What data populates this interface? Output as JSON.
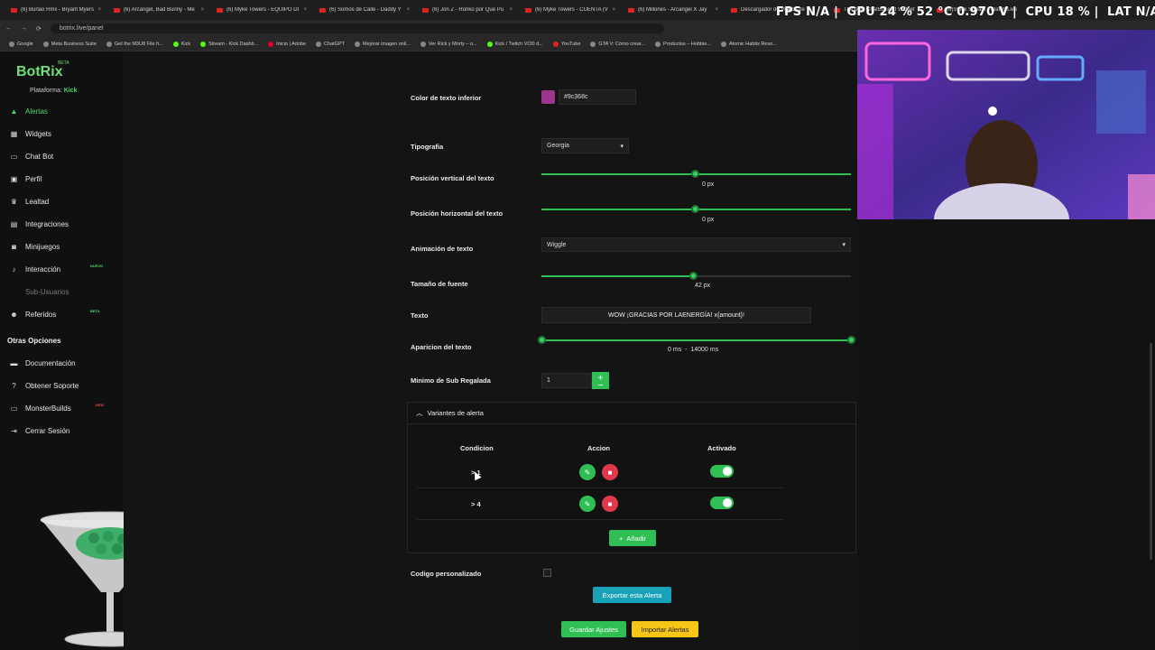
{
  "browser": {
    "tabs": [
      "(6) Burlao Rmx - Bryant Myers",
      "(6) Arcángel, Bad Bunny - Me",
      "(6) Myke Towers - EQUIPO DI",
      "(6) Somos de Calle - Daddy Y",
      "(6) Jon Z - Ronko por Que Pu",
      "(6) Myke Towers - CUENTA (V",
      "(6) Millones - Arcangel X Jay",
      "Descargador de Videos de Y",
      "The best ChatBot and Widget",
      "(6)Stock Stream - Watch Live"
    ],
    "url": "botrix.live/panel",
    "bookmarks": [
      "Google",
      "Meta Business Suite",
      "Get the M3U8 File fr...",
      "Kick",
      "Stream - Kick Dashb...",
      "Inicio | Adobe",
      "ChatGPT",
      "Mejorar imagen onli...",
      "Ver Rick y Morty – o...",
      "Kick / Twitch VOD d...",
      "YouTube",
      "GTA V: Cómo crear...",
      "Productos – Hobbie...",
      "Atomic Habits Reso..."
    ]
  },
  "overlay": {
    "fps_label": "FPS",
    "fps_value": "N/A",
    "gpu_label": "GPU",
    "gpu_value": "24 % 52 °C 0.970 V",
    "cpu_label": "CPU",
    "cpu_value": "18 %",
    "lat_label": "LAT",
    "lat_value": "N/A"
  },
  "sidebar": {
    "logo": "BotRix",
    "beta": "BETA",
    "platform_label": "Plataforma:",
    "platform_value": "Kick",
    "items": [
      {
        "label": "Alertas",
        "icon": "bell-icon"
      },
      {
        "label": "Widgets",
        "icon": "widgets-icon"
      },
      {
        "label": "Chat Bot",
        "icon": "chat-icon"
      },
      {
        "label": "Perfil",
        "icon": "profile-icon"
      },
      {
        "label": "Lealtad",
        "icon": "trophy-icon"
      },
      {
        "label": "Integraciones",
        "icon": "integrations-icon"
      },
      {
        "label": "Minijuegos",
        "icon": "gamepad-icon"
      },
      {
        "label": "Interacción",
        "icon": "music-icon",
        "tag": "NUEVO"
      },
      {
        "label": "Sub-Usuarios",
        "icon": "users-icon"
      },
      {
        "label": "Referidos",
        "icon": "referral-icon",
        "tag": "BETA"
      }
    ],
    "other_title": "Otras Opciones",
    "other_items": [
      {
        "label": "Documentación",
        "icon": "book-icon"
      },
      {
        "label": "Obtener Soporte",
        "icon": "help-icon"
      },
      {
        "label": "MonsterBuilds",
        "icon": "monitor-icon",
        "tag": "NEW"
      },
      {
        "label": "Cerrar Sesión",
        "icon": "logout-icon"
      }
    ]
  },
  "form": {
    "bottom_text_color_label": "Color de texto inferior",
    "bottom_text_color_value": "#9c368c",
    "typography_label": "Tipografia",
    "typography_value": "Georgia",
    "vpos_label": "Posición vertical del texto",
    "vpos_value": "0",
    "vpos_unit": "px",
    "hpos_label": "Posición horizontal del texto",
    "hpos_value": "0",
    "hpos_unit": "px",
    "anim_label": "Animación de texto",
    "anim_value": "Wiggle",
    "font_size_label": "Tamaño de fuente",
    "font_size_value": "42",
    "font_size_unit": "px",
    "text_label": "Texto",
    "text_value": "WOW ¡GRACIAS POR LAENERGÍA! x{amount}!",
    "appear_label": "Aparicion del texto",
    "appear_start": "0",
    "appear_end": "14000",
    "appear_unit": "ms",
    "appear_sep": "-",
    "min_sub_label": "Minimo de Sub Regalada",
    "min_sub_value": "1",
    "custom_code_label": "Codigo personalizado"
  },
  "variants": {
    "title": "Variantes de alerta",
    "col_condition": "Condicion",
    "col_action": "Accion",
    "col_enabled": "Activado",
    "rows": [
      {
        "condition": "> 1",
        "enabled": true
      },
      {
        "condition": "> 4",
        "enabled": true
      }
    ],
    "add_label": "Añadir"
  },
  "buttons": {
    "export": "Exportar esta Alerta",
    "save": "Guardar Ajustes",
    "import": "Importar Alertas"
  },
  "colors": {
    "accent_green": "#2fbf55",
    "teal": "#17a2b8",
    "yellow": "#f5c518",
    "danger": "#e0384a"
  }
}
